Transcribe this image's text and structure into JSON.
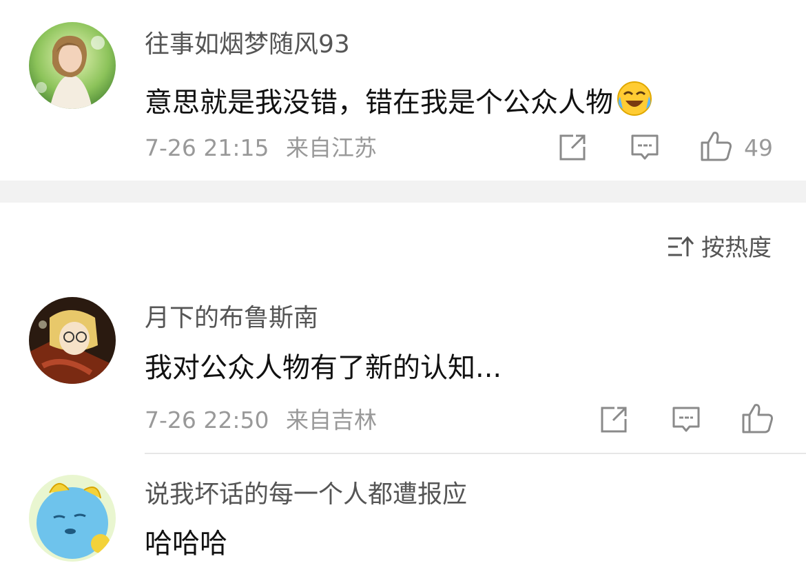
{
  "comments": [
    {
      "username": "往事如烟梦随风93",
      "content": "意思就是我没错，错在我是个公众人物",
      "content_emoji": "crying-laughing-emoji",
      "time": "7-26 21:15",
      "location": "来自江苏",
      "likes": "49"
    },
    {
      "username": "月下的布鲁斯南",
      "content": "我对公众人物有了新的认知...",
      "time": "7-26 22:50",
      "location": "来自吉林",
      "likes": ""
    },
    {
      "username": "说我坏话的每一个人都遭报应",
      "content": "哈哈哈"
    }
  ],
  "sort": {
    "label": "按热度",
    "icon": "sort-by-heat-icon"
  },
  "icons": {
    "forward": "share-icon",
    "comment": "comment-icon",
    "like": "thumbs-up-icon"
  },
  "colors": {
    "meta_text": "#999999",
    "body_text": "#111111",
    "separator": "#f2f2f2"
  }
}
